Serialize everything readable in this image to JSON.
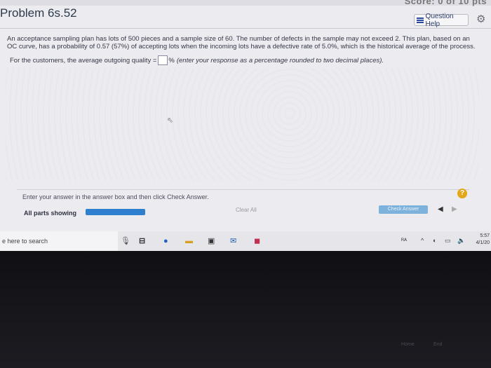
{
  "header": {
    "score_partial": "Score: 0 of 10 pts",
    "title": "Problem 6s.52",
    "help_label": "Question Help"
  },
  "question": {
    "text": "An acceptance sampling plan has lots of 500 pieces and a sample size of 60.  The number of defects in the sample may not exceed 2.  This plan, based on an OC curve, has a probability of 0.57 (57%) of accepting lots when the incoming lots have a defective rate of 5.0%, which is the historical average of the process.",
    "prompt_lead": "For the customers, the average outgoing quality =",
    "unit": "%",
    "hint": "(enter your response as a percentage rounded to two decimal places)."
  },
  "footer": {
    "instructions": "Enter your answer in the answer box and then click Check Answer.",
    "help_mark": "?",
    "parts_label": "All parts showing",
    "progress_fraction": 1.0,
    "clear_label": "Clear All",
    "check_label": "Check Answer",
    "prev_icon": "◀",
    "next_icon": "▶"
  },
  "taskbar": {
    "search_text": "e here to search",
    "time": "5:57",
    "date": "4/1/20"
  },
  "keyboard": {
    "keys": [
      "Home",
      "End"
    ]
  },
  "colors": {
    "accent": "#2f7fcf",
    "check_button": "#7db2dc",
    "help_badge": "#e2a818"
  }
}
